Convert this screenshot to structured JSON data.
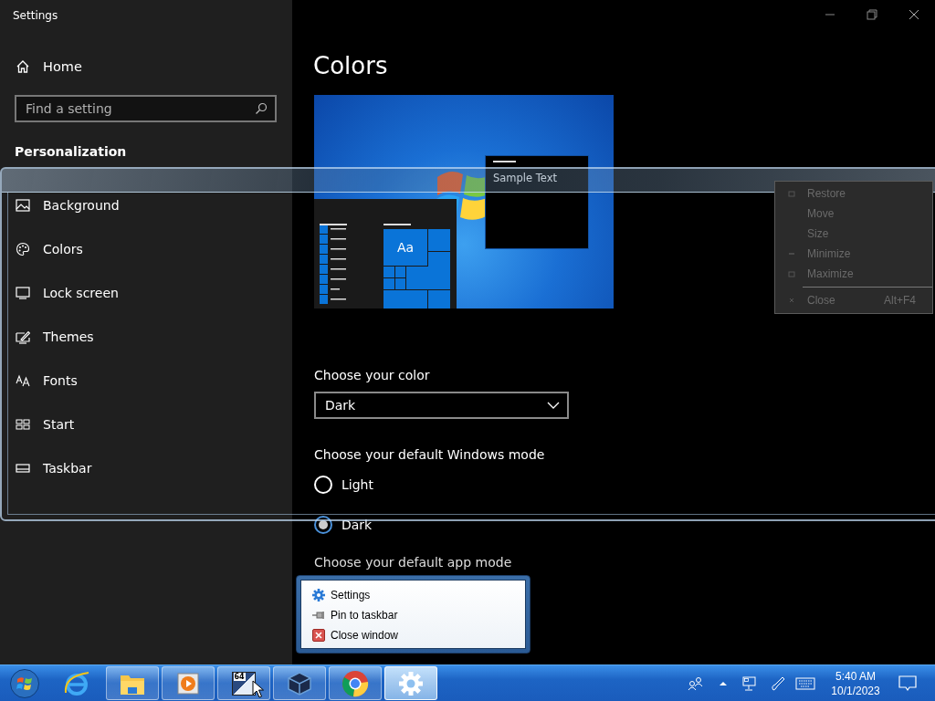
{
  "window": {
    "title": "Settings"
  },
  "sidebar": {
    "home": "Home",
    "search": {
      "placeholder": "Find a setting"
    },
    "section": "Personalization",
    "items": [
      {
        "label": "Background",
        "kind": "background"
      },
      {
        "label": "Colors",
        "kind": "colors"
      },
      {
        "label": "Lock screen",
        "kind": "lock"
      },
      {
        "label": "Themes",
        "kind": "themes"
      },
      {
        "label": "Fonts",
        "kind": "fonts"
      },
      {
        "label": "Start",
        "kind": "start"
      },
      {
        "label": "Taskbar",
        "kind": "taskbar"
      }
    ]
  },
  "page": {
    "title": "Colors",
    "preview": {
      "sample_text": "Sample Text",
      "tile_text": "Aa"
    },
    "color_label": "Choose your color",
    "color_value": "Dark",
    "mode_label": "Choose your default Windows mode",
    "mode_options": [
      {
        "label": "Light",
        "selected": false
      },
      {
        "label": "Dark",
        "selected": true
      }
    ],
    "app_mode_label": "Choose your default app mode"
  },
  "system_menu": {
    "items": [
      {
        "label": "Restore",
        "kind": "restore",
        "disabled": true
      },
      {
        "label": "Move",
        "kind": "move",
        "disabled": true
      },
      {
        "label": "Size",
        "kind": "size",
        "disabled": true
      },
      {
        "label": "Minimize",
        "kind": "minimize",
        "disabled": true
      },
      {
        "label": "Maximize",
        "kind": "maximize",
        "disabled": true
      },
      {
        "label": "Close",
        "kind": "close",
        "shortcut": "Alt+F4",
        "disabled": true
      }
    ]
  },
  "jump_list": {
    "items": [
      {
        "label": "Settings",
        "kind": "settings"
      },
      {
        "label": "Pin to taskbar",
        "kind": "pin"
      },
      {
        "label": "Close window",
        "kind": "close"
      }
    ]
  },
  "taskbar": {
    "items": [
      {
        "kind": "start",
        "selected": false
      },
      {
        "kind": "ie",
        "selected": false
      },
      {
        "kind": "explorer",
        "selected": false
      },
      {
        "kind": "media",
        "selected": false
      },
      {
        "kind": "app",
        "badge": "64",
        "selected": false
      },
      {
        "kind": "vbox",
        "selected": false
      },
      {
        "kind": "chrome",
        "selected": false
      },
      {
        "kind": "settings",
        "selected": true
      }
    ],
    "clock": {
      "time": "5:40 AM",
      "date": "10/1/2023"
    }
  }
}
